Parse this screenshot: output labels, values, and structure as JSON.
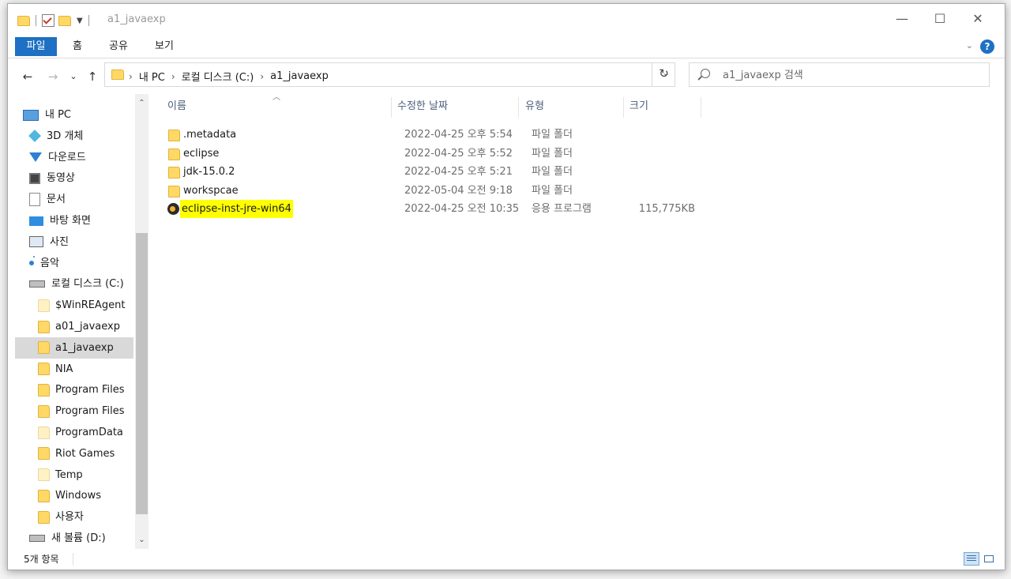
{
  "window": {
    "title": "a1_javaexp",
    "controls": {
      "minimize": "—",
      "maximize": "☐",
      "close": "✕"
    }
  },
  "ribbon": {
    "tabs": [
      "파일",
      "홈",
      "공유",
      "보기"
    ],
    "help": "?"
  },
  "nav": {
    "back": "←",
    "forward": "→",
    "recent": "⌄",
    "up": "↑",
    "breadcrumbs": [
      "내 PC",
      "로컬 디스크 (C:)",
      "a1_javaexp"
    ],
    "search_placeholder": "a1_javaexp 검색"
  },
  "sidebar": {
    "items": [
      {
        "label": "내 PC",
        "icon": "pc-icon",
        "indent": 0
      },
      {
        "label": "3D 개체",
        "icon": "cube-icon",
        "indent": 1
      },
      {
        "label": "다운로드",
        "icon": "download-icon",
        "indent": 1
      },
      {
        "label": "동영상",
        "icon": "video-icon",
        "indent": 1
      },
      {
        "label": "문서",
        "icon": "document-icon",
        "indent": 1
      },
      {
        "label": "바탕 화면",
        "icon": "desktop-icon",
        "indent": 1
      },
      {
        "label": "사진",
        "icon": "picture-icon",
        "indent": 1
      },
      {
        "label": "음악",
        "icon": "music-icon",
        "indent": 1
      },
      {
        "label": "로컬 디스크 (C:)",
        "icon": "drive-icon",
        "indent": 1
      },
      {
        "label": "$WinREAgent",
        "icon": "folder-icon",
        "indent": 2,
        "pale": true
      },
      {
        "label": "a01_javaexp",
        "icon": "folder-icon",
        "indent": 2
      },
      {
        "label": "a1_javaexp",
        "icon": "folder-icon",
        "indent": 2,
        "selected": true
      },
      {
        "label": "NIA",
        "icon": "folder-icon",
        "indent": 2
      },
      {
        "label": "Program Files",
        "icon": "folder-icon",
        "indent": 2
      },
      {
        "label": "Program Files",
        "icon": "folder-icon",
        "indent": 2
      },
      {
        "label": "ProgramData",
        "icon": "folder-icon",
        "indent": 2,
        "pale": true
      },
      {
        "label": "Riot Games",
        "icon": "folder-icon",
        "indent": 2
      },
      {
        "label": "Temp",
        "icon": "folder-icon",
        "indent": 2,
        "pale": true
      },
      {
        "label": "Windows",
        "icon": "folder-icon",
        "indent": 2
      },
      {
        "label": "사용자",
        "icon": "folder-icon",
        "indent": 2
      },
      {
        "label": "새 볼륨 (D:)",
        "icon": "drive-icon",
        "indent": 1
      }
    ]
  },
  "columns": {
    "name": "이름",
    "date": "수정한 날짜",
    "type": "유형",
    "size": "크기"
  },
  "files": [
    {
      "name": ".metadata",
      "date": "2022-04-25 오후 5:54",
      "type": "파일 폴더",
      "size": "",
      "kind": "folder"
    },
    {
      "name": "eclipse",
      "date": "2022-04-25 오후 5:52",
      "type": "파일 폴더",
      "size": "",
      "kind": "folder"
    },
    {
      "name": "jdk-15.0.2",
      "date": "2022-04-25 오후 5:21",
      "type": "파일 폴더",
      "size": "",
      "kind": "folder"
    },
    {
      "name": "workspcae",
      "date": "2022-05-04 오전 9:18",
      "type": "파일 폴더",
      "size": "",
      "kind": "folder"
    },
    {
      "name": "eclipse-inst-jre-win64",
      "date": "2022-04-25 오전 10:35",
      "type": "응용 프로그램",
      "size": "115,775KB",
      "kind": "exe",
      "highlighted": true
    }
  ],
  "status": {
    "item_count": "5개 항목"
  }
}
